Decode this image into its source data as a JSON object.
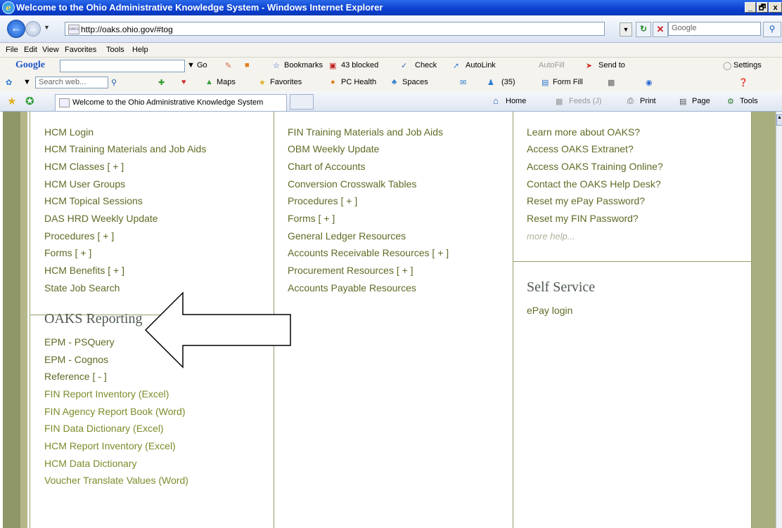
{
  "window": {
    "title": "Welcome to the Ohio Administrative Knowledge System - Windows Internet Explorer",
    "min": "_",
    "max": "🗗",
    "close": "x"
  },
  "address": {
    "url": "http://oaks.ohio.gov/#tog",
    "search_placeholder": "Google",
    "favicon_text": "OAKS"
  },
  "menu": [
    "File",
    "Edit",
    "View",
    "Favorites",
    "Tools",
    "Help"
  ],
  "google_toolbar": {
    "logo": "Google",
    "go": "Go",
    "bookmarks": "Bookmarks",
    "blocked": "43 blocked",
    "check": "Check",
    "autolink": "AutoLink",
    "autofill": "AutoFill",
    "sendto": "Send to",
    "settings": "Settings"
  },
  "live_toolbar": {
    "search_placeholder": "Search web...",
    "maps": "Maps",
    "favorites": "Favorites",
    "pchealth": "PC Health",
    "spaces": "Spaces",
    "count": "(35)",
    "formfill": "Form Fill"
  },
  "tabs": {
    "active_label": "Welcome to the Ohio Administrative Knowledge System"
  },
  "commands": {
    "home": "Home",
    "feeds": "Feeds (J)",
    "print": "Print",
    "page": "Page",
    "tools": "Tools"
  },
  "hcm_links": [
    "HCM Login",
    "HCM Training Materials and Job Aids",
    "HCM Classes [ + ]",
    "HCM User Groups",
    "HCM Topical Sessions",
    "DAS HRD Weekly Update",
    "Procedures [ + ]",
    "Forms [ + ]",
    "HCM Benefits [ + ]",
    "State Job Search"
  ],
  "reporting": {
    "title": "OAKS Reporting",
    "links": [
      "EPM - PSQuery",
      "EPM - Cognos",
      "Reference [ - ]"
    ],
    "sublinks": [
      "FIN Report Inventory (Excel)",
      "FIN Agency Report Book (Word)",
      "FIN Data Dictionary (Excel)",
      "HCM Report Inventory (Excel)",
      "HCM Data Dictionary",
      "Voucher Translate Values (Word)"
    ]
  },
  "fin_links": [
    "FIN Training Materials and Job Aids",
    "OBM Weekly Update",
    "Chart of Accounts",
    "Conversion Crosswalk Tables",
    "Procedures [ + ]",
    "Forms [ + ]",
    "General Ledger Resources",
    "Accounts Receivable Resources [ + ]",
    "Procurement Resources [ + ]",
    "Accounts Payable Resources"
  ],
  "help_links": [
    "Learn more about OAKS?",
    "Access OAKS Extranet?",
    "Access OAKS Training Online?",
    "Contact the OAKS Help Desk?",
    "Reset my ePay Password?",
    "Reset my FIN Password?"
  ],
  "more_help": "more help...",
  "self_service": {
    "title": "Self Service",
    "link": "ePay login"
  },
  "colors": {
    "link": "#616b26",
    "heading": "#4f5a4e",
    "border": "#94a06e"
  }
}
